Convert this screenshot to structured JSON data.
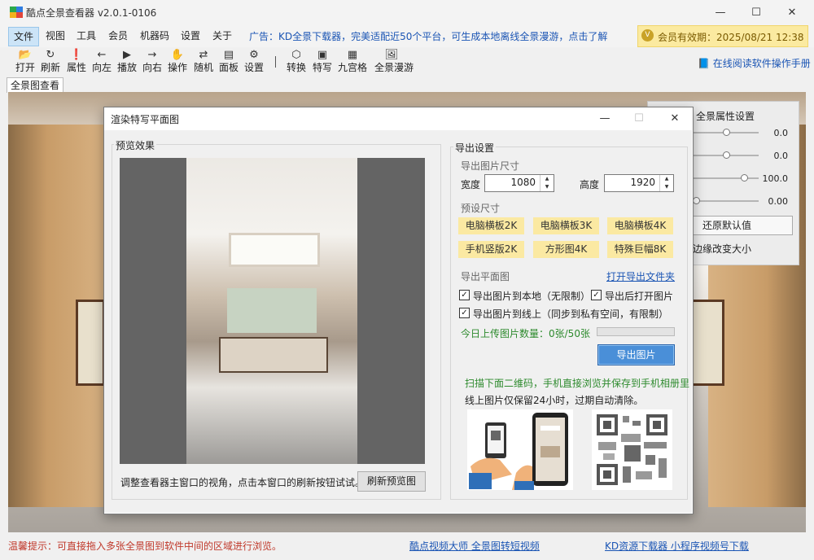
{
  "app": {
    "title": "酷点全景查看器 v2.0.1-0106"
  },
  "window_controls": {
    "minimize": "—",
    "maximize": "☐",
    "close": "✕"
  },
  "menu": {
    "items": [
      "文件",
      "视图",
      "工具",
      "会员",
      "机器码",
      "设置",
      "关于"
    ]
  },
  "ad": {
    "text": "广告：KD全景下载器，完美适配近50个平台，可生成本地离线全景漫游，点击了解"
  },
  "member": {
    "text": "会员有效期：2025/08/21 12:38"
  },
  "toolbar": {
    "items": [
      "打开",
      "刷新",
      "属性",
      "向左",
      "播放",
      "向右",
      "操作",
      "随机",
      "面板",
      "设置",
      "转换",
      "特写",
      "九宫格",
      "全景漫游"
    ],
    "manual": "在线阅读软件操作手册"
  },
  "tab": {
    "label": "全景图查看"
  },
  "props_panel": {
    "title": "全景属性设置",
    "values": [
      "0.0",
      "0.0",
      "100.0",
      "0.00"
    ],
    "reset": "还原默认值",
    "edge": "边缘改变大小"
  },
  "dialog": {
    "title": "渲染特写平面图",
    "close": "✕",
    "preview": {
      "label": "预览效果",
      "hint": "调整查看器主窗口的视角，点击本窗口的刷新按钮试试。",
      "refresh": "刷新预览图"
    },
    "export": {
      "label": "导出设置",
      "size_label": "导出图片尺寸",
      "width_label": "宽度",
      "width": "1080",
      "height_label": "高度",
      "height": "1920",
      "preset_label": "预设尺寸",
      "presets": [
        "电脑横板2K",
        "电脑横板3K",
        "电脑横板4K",
        "手机竖版2K",
        "方形图4K",
        "特殊巨幅8K"
      ],
      "plane_label": "导出平面图",
      "open_folder": "打开导出文件夹",
      "chk_local": "导出图片到本地（无限制）",
      "chk_open": "导出后打开图片",
      "chk_online": "导出图片到线上（同步到私有空间，有限制）",
      "upload_count": "今日上传图片数量：0张/50张",
      "export_btn": "导出图片",
      "qr_tip1": "扫描下面二维码，手机直接浏览并保存到手机相册里",
      "qr_tip2": "线上图片仅保留24小时，过期自动清除。"
    }
  },
  "status": {
    "tip": "温馨提示：可直接拖入多张全景图到软件中间的区域进行浏览。",
    "link1": "酷点视频大师 全景图转短视频",
    "link2": "KD资源下载器 小程序视频号下载"
  },
  "colors": {
    "link": "#1b55b4",
    "tip": "#c0392b",
    "preset": "#fbe9a2",
    "export_btn": "#4a8fd8",
    "member": "#fbeaa0"
  }
}
